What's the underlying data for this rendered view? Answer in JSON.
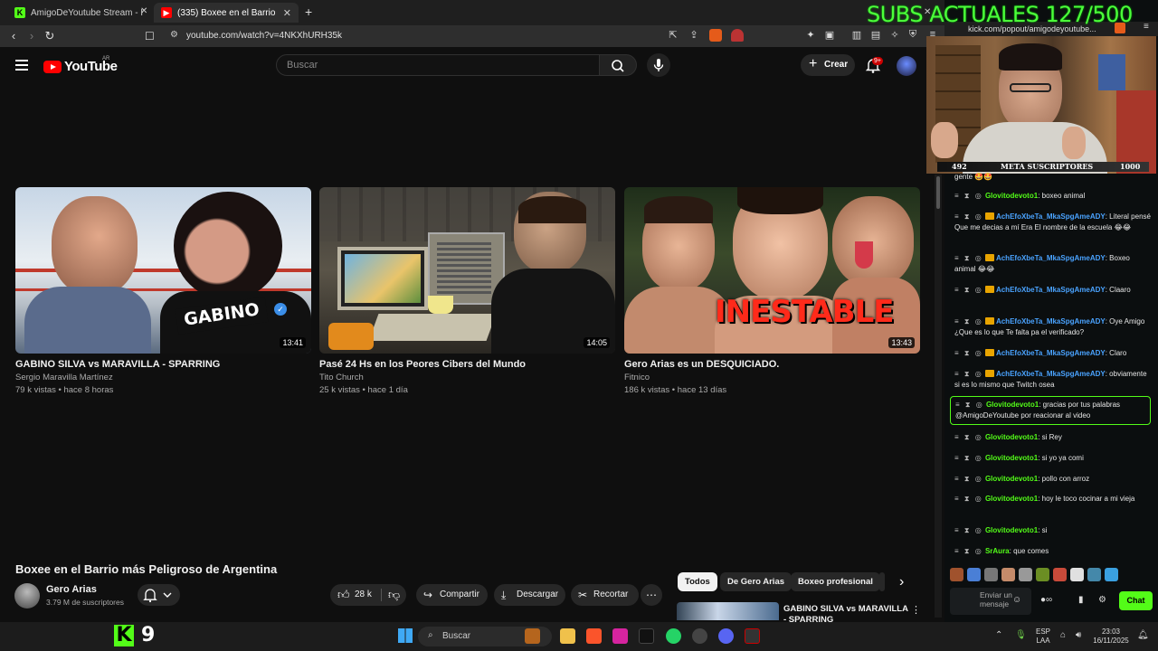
{
  "browser": {
    "tabs": [
      {
        "title": "AmigoDeYoutube Stream - Kick",
        "icon": "kick-icon"
      },
      {
        "title": "(335) Boxee en el Barrio más Peli",
        "icon": "youtube-icon"
      }
    ],
    "url": "youtube.com/watch?v=4NKXhURH35k",
    "chat_url": "kick.com/popout/amigodeyoutube..."
  },
  "youtube": {
    "logo": "YouTube",
    "region": "AR",
    "search_placeholder": "Buscar",
    "create_label": "Crear",
    "notifications": "9+"
  },
  "videos": [
    {
      "title": "GABINO SILVA vs MARAVILLA - SPARRING",
      "channel": "Sergio Maravilla Martínez",
      "meta": "79 k vistas • hace 8 horas",
      "duration": "13:41",
      "overlay": "GABINO"
    },
    {
      "title": "Pasé 24 Hs en los Peores Cibers del Mundo",
      "channel": "Tito Church",
      "meta": "25 k vistas • hace 1 día",
      "duration": "14:05",
      "overlay": ""
    },
    {
      "title": "Gero Arias es un DESQUICIADO.",
      "channel": "Fitnico",
      "meta": "186 k vistas • hace 13 días",
      "duration": "13:43",
      "overlay": "INESTABLE"
    }
  ],
  "current_video": {
    "title": "Boxee en el Barrio más Peligroso de Argentina",
    "channel": "Gero Arias",
    "subscribers": "3.79 M de suscriptores",
    "likes": "28 k",
    "share": "Compartir",
    "download": "Descargar",
    "clip": "Recortar"
  },
  "chips": [
    "Todos",
    "De Gero Arias",
    "Boxeo profesional"
  ],
  "suggested": {
    "title": "GABINO SILVA vs MARAVILLA - SPARRING"
  },
  "overlay": {
    "subs_goal": "SUBS ACTUALES 127/500",
    "meta_left": "492",
    "meta_label": "META SUSCRIPTORES",
    "meta_right": "1000"
  },
  "chat": {
    "messages": [
      {
        "user": "",
        "text": "gente 🤩🤩",
        "color": "g"
      },
      {
        "user": "Glovitodevoto1",
        "text": ": boxeo animal",
        "color": "g"
      },
      {
        "user": "AchEfoXbeTa_MkaSpgAmeADY",
        "text": ": Literal pensé Que me decias a mí Era El nombre de la escuela 😂😂",
        "color": "b"
      },
      {
        "user": "AchEfoXbeTa_MkaSpgAmeADY",
        "text": ": Boxeo animal 😂😂",
        "color": "b"
      },
      {
        "user": "AchEfoXbeTa_MkaSpgAmeADY",
        "text": ": Claaro",
        "color": "b"
      },
      {
        "user": "AchEfoXbeTa_MkaSpgAmeADY",
        "text": ": Oye Amigo ¿Que es lo que Te falta pa el verificado?",
        "color": "b"
      },
      {
        "user": "AchEfoXbeTa_MkaSpgAmeADY",
        "text": ": Claro",
        "color": "b"
      },
      {
        "user": "AchEfoXbeTa_MkaSpgAmeADY",
        "text": ": obviamente si es lo mismo que Twitch osea",
        "color": "b"
      },
      {
        "user": "Glovitodevoto1",
        "text": ": gracias por tus palabras @AmigoDeYoutube por reacionar al video",
        "color": "g"
      },
      {
        "user": "Glovitodevoto1",
        "text": ": si Rey",
        "color": "g"
      },
      {
        "user": "Glovitodevoto1",
        "text": ": si yo ya comi",
        "color": "g"
      },
      {
        "user": "Glovitodevoto1",
        "text": ": pollo con arroz",
        "color": "g"
      },
      {
        "user": "Glovitodevoto1",
        "text": ": hoy le toco cocinar a mi vieja",
        "color": "g"
      },
      {
        "user": "Glovitodevoto1",
        "text": ": si",
        "color": "g"
      },
      {
        "user": "SrAura",
        "text": ": que comes",
        "color": "g"
      }
    ],
    "input_placeholder": "Enviar un mensaje",
    "send_label": "Chat"
  },
  "taskbar": {
    "viewer_count": "9",
    "search": "Buscar",
    "lang": "ESP",
    "layout": "LAA",
    "time": "23:03",
    "date": "16/11/2025"
  }
}
